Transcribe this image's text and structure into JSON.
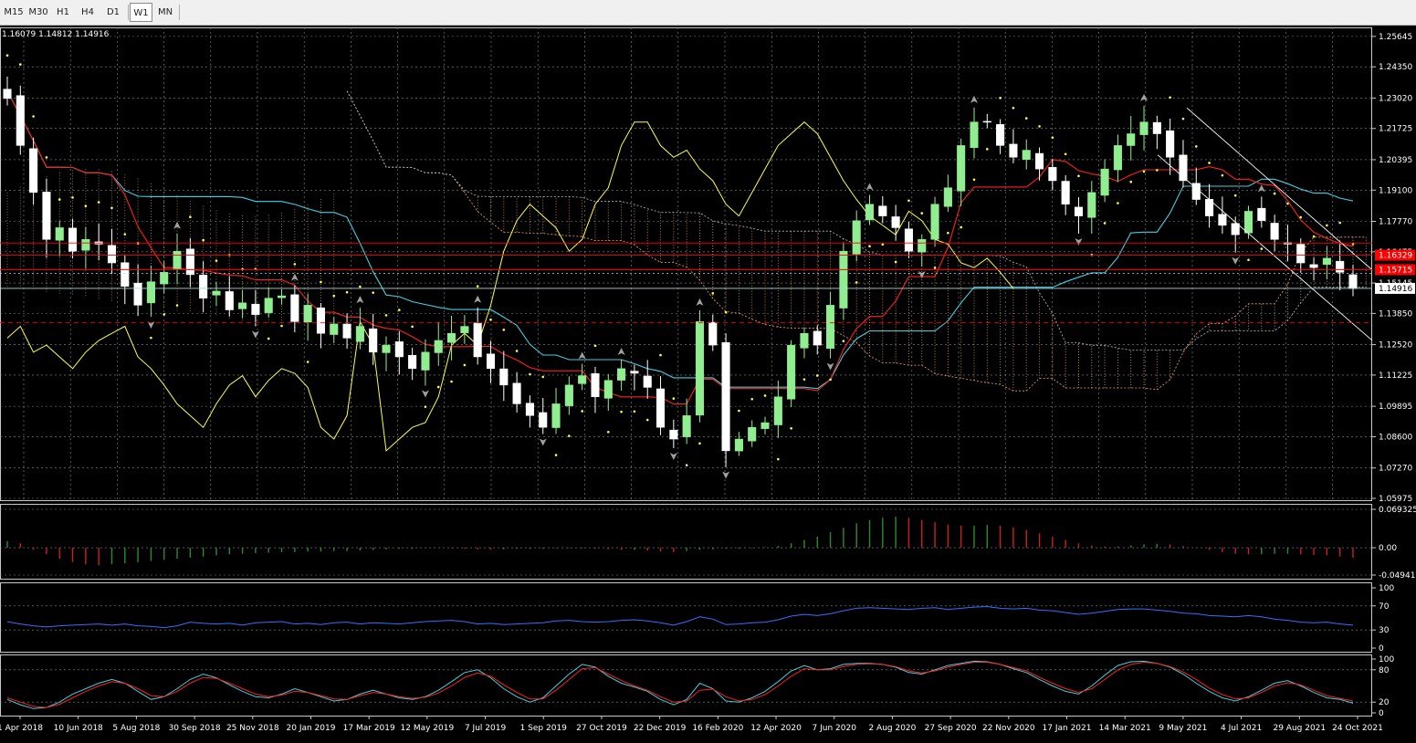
{
  "toolbar": {
    "timeframes": [
      {
        "label": "M15",
        "active": false
      },
      {
        "label": "M30",
        "active": false
      },
      {
        "label": "H1",
        "active": false
      },
      {
        "label": "H4",
        "active": false
      },
      {
        "label": "D1",
        "active": false
      },
      {
        "label": "W1",
        "active": true
      },
      {
        "label": "MN",
        "active": false
      }
    ]
  },
  "ohlc_info": "1.16079 1.14812 1.14916",
  "colors": {
    "bull": "#90ee90",
    "bear": "#ffffff",
    "tenkan": "#ff2020",
    "kijun": "#40d0e0",
    "chikou": "#ffff40",
    "psar": "#ffff40",
    "grid": "#8a8a8a",
    "macd_up": "#2e8b2e",
    "macd_down": "#cc2020",
    "rsi": "#3c6cff",
    "stoch_main": "#40d0e0",
    "stoch_signal": "#ff2020",
    "price_tag": "#ff0000"
  },
  "chart_data": [
    {
      "type": "candlestick",
      "name": "main",
      "ylim": [
        1.05975,
        1.2564
      ],
      "ticks": [
        "1.25645",
        "1.24350",
        "1.23020",
        "1.21725",
        "1.20395",
        "1.19100",
        "1.17770",
        "1.16475",
        "1.15145",
        "1.13850",
        "1.12520",
        "1.11225",
        "1.09895",
        "1.08600",
        "1.07270",
        "1.05975"
      ],
      "tick_values": [
        1.25645,
        1.2435,
        1.2302,
        1.21725,
        1.20395,
        1.191,
        1.1777,
        1.16475,
        1.15145,
        1.1385,
        1.1252,
        1.11225,
        1.09895,
        1.086,
        1.0727,
        1.05975
      ],
      "current_price": "1.14916",
      "current_value": 1.14916,
      "price_tags": [
        "1.16329",
        "1.15715"
      ],
      "price_tag_values": [
        1.16329,
        1.15715
      ],
      "x_labels": [
        "1 Apr 2018",
        "10 Jun 2018",
        "5 Aug 2018",
        "30 Sep 2018",
        "25 Nov 2018",
        "20 Jan 2019",
        "17 Mar 2019",
        "12 May 2019",
        "7 Jul 2019",
        "1 Sep 2019",
        "27 Oct 2019",
        "22 Dec 2019",
        "16 Feb 2020",
        "12 Apr 2020",
        "7 Jun 2020",
        "2 Aug 2020",
        "27 Sep 2020",
        "22 Nov 2020",
        "17 Jan 2021",
        "14 Mar 2021",
        "9 May 2021",
        "4 Jul 2021",
        "29 Aug 2021",
        "24 Oct 2021"
      ],
      "closes": [
        1.23,
        1.21,
        1.19,
        1.17,
        1.175,
        1.165,
        1.17,
        1.168,
        1.16,
        1.15,
        1.142,
        1.152,
        1.156,
        1.165,
        1.155,
        1.145,
        1.148,
        1.14,
        1.143,
        1.138,
        1.145,
        1.146,
        1.135,
        1.142,
        1.13,
        1.134,
        1.128,
        1.133,
        1.122,
        1.125,
        1.12,
        1.115,
        1.122,
        1.127,
        1.13,
        1.133,
        1.12,
        1.115,
        1.108,
        1.1,
        1.095,
        1.09,
        1.1,
        1.108,
        1.112,
        1.103,
        1.11,
        1.115,
        1.113,
        1.107,
        1.09,
        1.085,
        1.095,
        1.135,
        1.125,
        1.08,
        1.085,
        1.09,
        1.092,
        1.103,
        1.125,
        1.13,
        1.125,
        1.142,
        1.165,
        1.178,
        1.185,
        1.18,
        1.175,
        1.165,
        1.17,
        1.185,
        1.192,
        1.21,
        1.22,
        1.22,
        1.21,
        1.205,
        1.208,
        1.2,
        1.195,
        1.185,
        1.18,
        1.19,
        1.2,
        1.21,
        1.215,
        1.22,
        1.215,
        1.205,
        1.195,
        1.187,
        1.18,
        1.176,
        1.172,
        1.182,
        1.178,
        1.17,
        1.168,
        1.16,
        1.158,
        1.162,
        1.156,
        1.1491
      ],
      "series": [
        {
          "name": "Tenkan-sen"
        },
        {
          "name": "Kijun-sen"
        },
        {
          "name": "Chikou Span"
        },
        {
          "name": "Senkou Span A"
        },
        {
          "name": "Senkou Span B"
        },
        {
          "name": "Parabolic SAR"
        }
      ]
    },
    {
      "type": "bar",
      "name": "macd",
      "ylim": [
        -0.049419,
        0.069325
      ],
      "ticks": [
        "0.069325",
        "0.00",
        "-0.049419"
      ],
      "tick_values": [
        0.069325,
        0.0,
        -0.049419
      ],
      "values": [
        0.012,
        0.008,
        -0.004,
        -0.012,
        -0.02,
        -0.026,
        -0.03,
        -0.032,
        -0.03,
        -0.028,
        -0.026,
        -0.024,
        -0.022,
        -0.02,
        -0.018,
        -0.016,
        -0.014,
        -0.012,
        -0.011,
        -0.01,
        -0.009,
        -0.008,
        -0.008,
        -0.007,
        -0.007,
        -0.006,
        -0.006,
        -0.005,
        -0.004,
        -0.003,
        -0.002,
        -0.002,
        -0.001,
        0.0,
        -0.001,
        -0.002,
        -0.003,
        -0.004,
        -0.003,
        -0.002,
        -0.002,
        -0.002,
        -0.001,
        -0.001,
        -0.001,
        -0.002,
        -0.003,
        -0.004,
        -0.004,
        -0.005,
        -0.007,
        -0.008,
        -0.006,
        -0.004,
        -0.003,
        -0.002,
        -0.002,
        -0.001,
        0.001,
        0.003,
        0.008,
        0.014,
        0.02,
        0.028,
        0.036,
        0.044,
        0.05,
        0.054,
        0.056,
        0.054,
        0.05,
        0.046,
        0.042,
        0.04,
        0.04,
        0.041,
        0.04,
        0.037,
        0.032,
        0.026,
        0.02,
        0.014,
        0.008,
        0.004,
        0.002,
        0.002,
        0.004,
        0.006,
        0.007,
        0.006,
        0.003,
        0.0,
        -0.004,
        -0.008,
        -0.011,
        -0.012,
        -0.012,
        -0.011,
        -0.011,
        -0.012,
        -0.013,
        -0.014,
        -0.016,
        -0.018
      ]
    },
    {
      "type": "line",
      "name": "rsi",
      "ylim": [
        0,
        100
      ],
      "ticks": [
        "100",
        "70",
        "30",
        "0"
      ],
      "tick_values": [
        100,
        70,
        30,
        0
      ],
      "values": [
        44,
        40,
        37,
        35,
        37,
        38,
        39,
        40,
        38,
        40,
        37,
        36,
        34,
        37,
        43,
        41,
        40,
        41,
        38,
        42,
        43,
        44,
        40,
        41,
        39,
        42,
        43,
        40,
        42,
        41,
        40,
        42,
        44,
        45,
        46,
        44,
        40,
        41,
        39,
        40,
        41,
        42,
        45,
        46,
        44,
        43,
        44,
        46,
        47,
        45,
        42,
        38,
        44,
        52,
        48,
        39,
        40,
        42,
        43,
        47,
        53,
        56,
        54,
        57,
        62,
        66,
        67,
        66,
        65,
        64,
        66,
        67,
        64,
        66,
        68,
        69,
        66,
        65,
        66,
        63,
        62,
        59,
        56,
        58,
        61,
        64,
        65,
        65,
        63,
        61,
        58,
        57,
        54,
        53,
        52,
        54,
        52,
        48,
        46,
        43,
        42,
        43,
        40,
        38
      ]
    },
    {
      "type": "line",
      "name": "stochastic",
      "ylim": [
        0,
        100
      ],
      "ticks": [
        "100",
        "80",
        "20",
        "0"
      ],
      "tick_values": [
        100,
        80,
        20,
        0
      ],
      "series": [
        {
          "values": [
            25,
            15,
            8,
            10,
            20,
            35,
            45,
            55,
            62,
            55,
            40,
            25,
            30,
            45,
            62,
            72,
            65,
            52,
            40,
            30,
            28,
            35,
            45,
            38,
            30,
            22,
            25,
            35,
            42,
            35,
            28,
            25,
            30,
            42,
            58,
            75,
            80,
            65,
            45,
            30,
            20,
            28,
            50,
            72,
            90,
            85,
            68,
            55,
            48,
            40,
            25,
            15,
            25,
            55,
            45,
            22,
            20,
            28,
            40,
            58,
            78,
            88,
            80,
            82,
            90,
            92,
            92,
            90,
            85,
            75,
            72,
            80,
            88,
            92,
            96,
            95,
            90,
            82,
            75,
            62,
            50,
            40,
            35,
            50,
            70,
            88,
            95,
            96,
            92,
            85,
            72,
            55,
            40,
            28,
            22,
            30,
            42,
            55,
            60,
            50,
            38,
            28,
            25,
            18
          ]
        },
        {
          "values": [
            28,
            20,
            12,
            10,
            16,
            28,
            40,
            50,
            58,
            55,
            45,
            32,
            30,
            40,
            55,
            66,
            64,
            55,
            45,
            35,
            30,
            33,
            40,
            38,
            32,
            26,
            25,
            32,
            38,
            35,
            30,
            27,
            29,
            37,
            50,
            66,
            74,
            68,
            52,
            38,
            26,
            26,
            42,
            62,
            82,
            84,
            72,
            60,
            50,
            42,
            30,
            20,
            22,
            42,
            44,
            30,
            22,
            25,
            34,
            50,
            68,
            82,
            80,
            80,
            86,
            90,
            91,
            90,
            86,
            78,
            74,
            78,
            85,
            90,
            94,
            94,
            90,
            84,
            78,
            66,
            55,
            45,
            38,
            45,
            62,
            80,
            90,
            94,
            92,
            86,
            76,
            62,
            46,
            34,
            26,
            28,
            38,
            50,
            56,
            52,
            42,
            32,
            27,
            22
          ]
        }
      ]
    }
  ]
}
